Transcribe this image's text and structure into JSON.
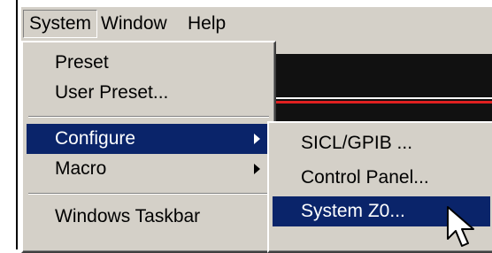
{
  "menubar": {
    "items": [
      "System",
      "Window",
      "Help"
    ]
  },
  "system_menu": {
    "items": [
      "Preset",
      "User Preset...",
      "Configure",
      "Macro",
      "Windows Taskbar"
    ]
  },
  "configure_submenu": {
    "items": [
      "SICL/GPIB ...",
      "Control Panel...",
      "System Z0..."
    ]
  },
  "colors": {
    "menu_face": "#d4d0c8",
    "highlight": "#0a246a",
    "display_bg": "#111111",
    "trace_red": "#e02020"
  }
}
